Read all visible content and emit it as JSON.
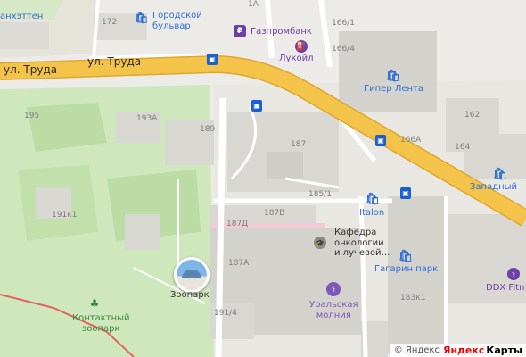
{
  "map": {
    "streets": [
      {
        "id": "trud-left",
        "label": "ул. Труда"
      },
      {
        "id": "trud-center",
        "label": "ул. Труда"
      }
    ],
    "building_numbers": [
      "1A",
      "172",
      "166/1",
      "166/4",
      "195",
      "193A",
      "189",
      "187",
      "162",
      "166A",
      "164",
      "185/1",
      "187B",
      "187Д",
      "191к1",
      "187A",
      "183к1",
      "191/4"
    ],
    "pois": [
      {
        "id": "manhattan",
        "label": "анхэттен",
        "category": "shop"
      },
      {
        "id": "gorodskoy-bulvar",
        "label": "Городской\nбульвар",
        "category": "shop"
      },
      {
        "id": "gazprombank",
        "label": "Газпромбанк",
        "category": "bank"
      },
      {
        "id": "lukoil",
        "label": "Лукойл",
        "category": "fuel"
      },
      {
        "id": "giper-lenta",
        "label": "Гипер Лента",
        "category": "shop"
      },
      {
        "id": "zapadny",
        "label": "Западный",
        "category": "shop"
      },
      {
        "id": "italon",
        "label": "Italon",
        "category": "shop"
      },
      {
        "id": "kafedra",
        "label": "Кафедра\nонкологии\nи лучевой…",
        "category": "education"
      },
      {
        "id": "gagarin-park",
        "label": "Гагарин парк",
        "category": "shop"
      },
      {
        "id": "ddx",
        "label": "DDX Fitn",
        "category": "fitness"
      },
      {
        "id": "uralskaya-molniya",
        "label": "Уральская\nмолния",
        "category": "fitness"
      },
      {
        "id": "zoopark",
        "label": "Зоопарк",
        "category": "landmark"
      },
      {
        "id": "kontaktny-zoopark",
        "label": "Контактный\nзоопарк",
        "category": "park"
      }
    ],
    "copyright": {
      "text": "© Яндекс",
      "brand_red": "Яндекс",
      "brand_black": "Карты"
    },
    "colors": {
      "road_major": "#f3c34a",
      "road_minor": "#ffffff",
      "park": "#c9e3b4",
      "building": "#d9d7d2",
      "poi_blue": "#2f6fd3",
      "poi_violet": "#6d3fa8",
      "bus_stop": "#1b5fd0",
      "hospital_area": "#f2c9d8"
    }
  }
}
